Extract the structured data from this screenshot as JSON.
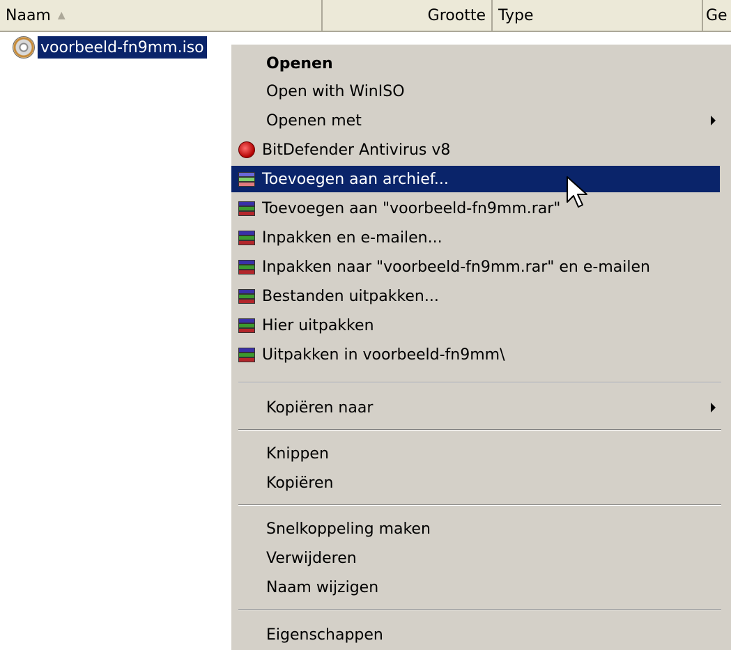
{
  "header": {
    "name_label": "Naam",
    "size_label": "Grootte",
    "type_label": "Type",
    "date_label": "Ge"
  },
  "file": {
    "name": "voorbeeld-fn9mm.iso",
    "icon": "disc-image-icon"
  },
  "menu": {
    "open": "Openen",
    "open_winiso": "Open with WinISO",
    "open_with": "Openen met",
    "bitdefender": "BitDefender Antivirus v8",
    "add_archive": "Toevoegen aan archief...",
    "add_rar": "Toevoegen aan \"voorbeeld-fn9mm.rar\"",
    "pack_email": "Inpakken en e-mailen...",
    "pack_rar_email": "Inpakken naar \"voorbeeld-fn9mm.rar\" en e-mailen",
    "extract_files": "Bestanden uitpakken...",
    "extract_here": "Hier uitpakken",
    "extract_to": "Uitpakken in voorbeeld-fn9mm\\",
    "copy_to": "Kopiëren naar",
    "cut": "Knippen",
    "copy": "Kopiëren",
    "create_shortcut": "Snelkoppeling maken",
    "delete": "Verwijderen",
    "rename": "Naam wijzigen",
    "properties": "Eigenschappen"
  },
  "colors": {
    "menu_bg": "#d4d0c8",
    "highlight": "#0a246a"
  }
}
